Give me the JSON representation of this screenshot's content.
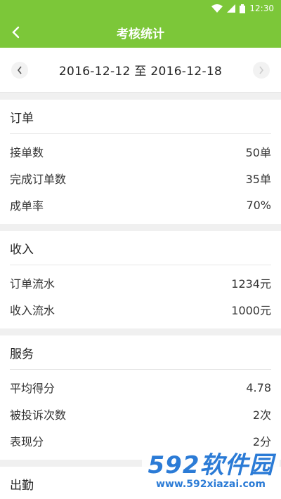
{
  "status_bar": {
    "time": "12:30"
  },
  "header": {
    "title": "考核统计"
  },
  "date_range": {
    "text": "2016-12-12 至 2016-12-18"
  },
  "sections": [
    {
      "title": "订单",
      "rows": [
        {
          "label": "接单数",
          "value": "50单"
        },
        {
          "label": "完成订单数",
          "value": "35单"
        },
        {
          "label": "成单率",
          "value": "70%"
        }
      ]
    },
    {
      "title": "收入",
      "rows": [
        {
          "label": "订单流水",
          "value": "1234元"
        },
        {
          "label": "收入流水",
          "value": "1000元"
        }
      ]
    },
    {
      "title": "服务",
      "rows": [
        {
          "label": "平均得分",
          "value": "4.78"
        },
        {
          "label": "被投诉次数",
          "value": "2次"
        },
        {
          "label": "表现分",
          "value": "2分"
        }
      ]
    },
    {
      "title": "出勤",
      "rows": []
    }
  ],
  "watermark": {
    "logo": "592软件园",
    "url": "www.592xiazai.com"
  },
  "colors": {
    "brand": "#7cc739",
    "watermark": "#2b7bd6"
  }
}
